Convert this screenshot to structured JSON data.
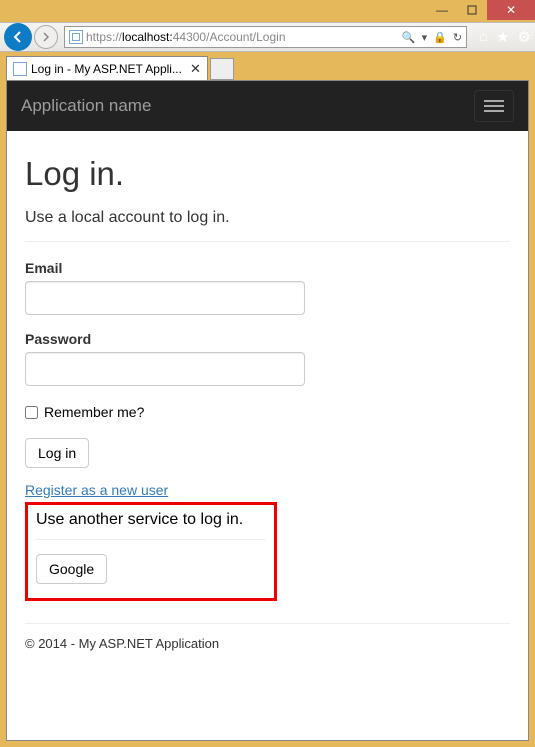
{
  "window": {
    "min": "—",
    "close": "✕"
  },
  "toolbar": {
    "url_prefix": "https://",
    "url_host": "localhost:",
    "url_rest": "44300/Account/Login",
    "search_icon": "🔍",
    "lock_icon": "🔒",
    "refresh_icon": "↻",
    "home_icon": "⌂",
    "star_icon": "★",
    "gear_icon": "⚙"
  },
  "tab": {
    "title": "Log in - My ASP.NET Appli...",
    "close": "✕"
  },
  "navbar": {
    "brand": "Application name"
  },
  "page": {
    "heading": "Log in.",
    "subhead": "Use a local account to log in.",
    "email_label": "Email",
    "password_label": "Password",
    "remember_label": "Remember me?",
    "login_btn": "Log in",
    "register_link": "Register as a new user",
    "ext_head": "Use another service to log in.",
    "google_btn": "Google",
    "footer": "© 2014 - My ASP.NET Application"
  }
}
